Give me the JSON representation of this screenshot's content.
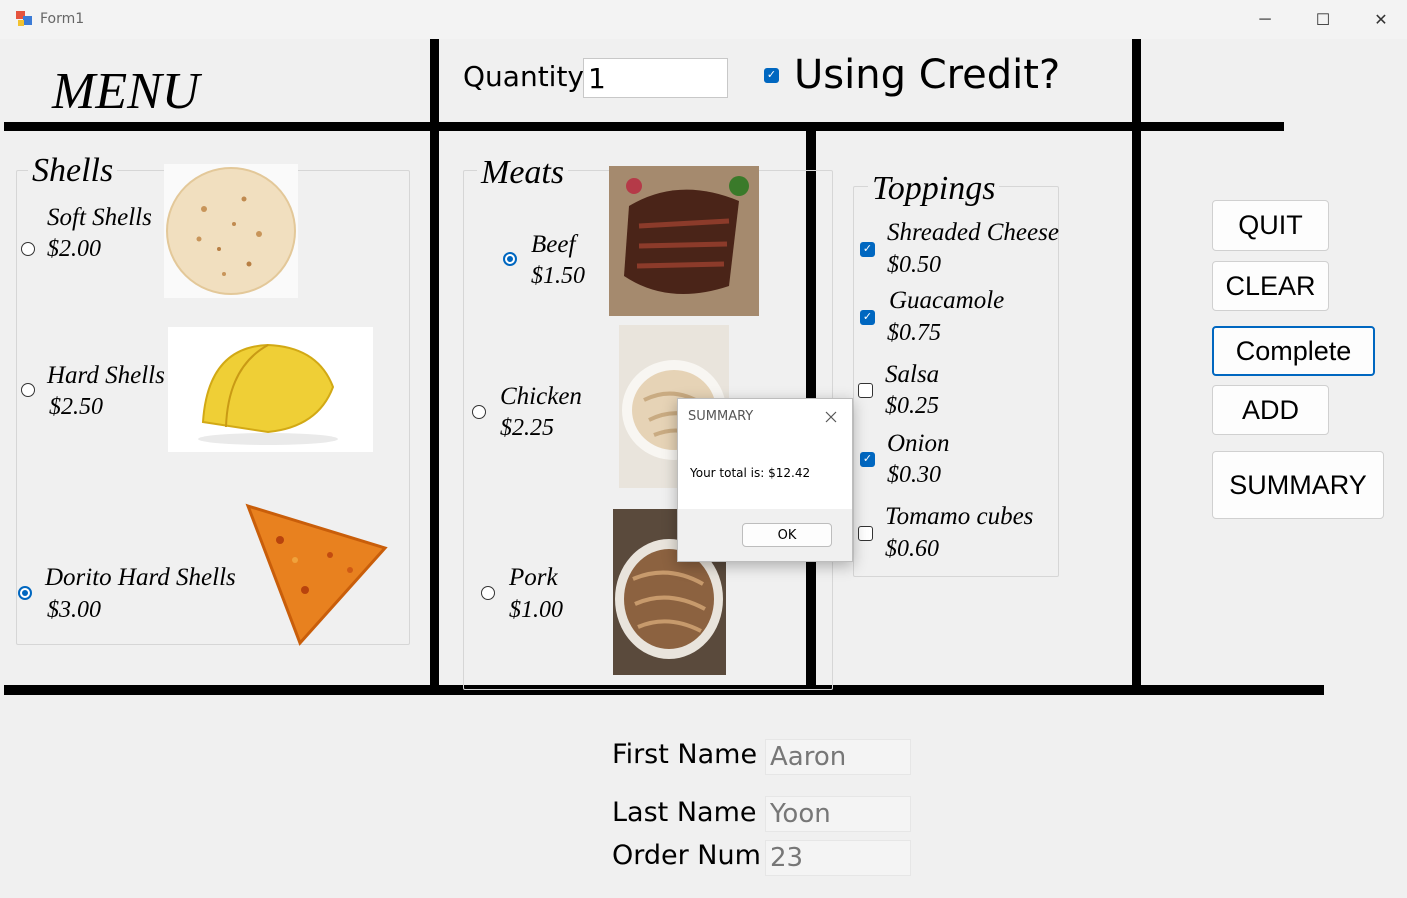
{
  "window": {
    "title": "Form1",
    "controls": {
      "minimize": "─",
      "maximize": "☐",
      "close": "✕"
    }
  },
  "header": {
    "menu_title": "MENU",
    "quantity_label": "Quantity",
    "quantity_value": "1",
    "using_credit_label": "Using Credit?",
    "using_credit_checked": true
  },
  "shells": {
    "title": "Shells",
    "items": [
      {
        "name": "Soft Shells",
        "price": "$2.00",
        "selected": false
      },
      {
        "name": "Hard Shells",
        "price": "$2.50",
        "selected": false
      },
      {
        "name": "Dorito Hard Shells",
        "price": "$3.00",
        "selected": true
      }
    ]
  },
  "meats": {
    "title": "Meats",
    "items": [
      {
        "name": "Beef",
        "price": "$1.50",
        "selected": true
      },
      {
        "name": "Chicken",
        "price": "$2.25",
        "selected": false
      },
      {
        "name": "Pork",
        "price": "$1.00",
        "selected": false
      }
    ]
  },
  "toppings": {
    "title": "Toppings",
    "items": [
      {
        "name": "Shreaded Cheese",
        "price": "$0.50",
        "checked": true
      },
      {
        "name": "Guacamole",
        "price": "$0.75",
        "checked": true
      },
      {
        "name": "Salsa",
        "price": "$0.25",
        "checked": false
      },
      {
        "name": "Onion",
        "price": "$0.30",
        "checked": true
      },
      {
        "name": "Tomamo cubes",
        "price": "$0.60",
        "checked": false
      }
    ]
  },
  "buttons": {
    "quit": "QUIT",
    "clear": "CLEAR",
    "complete": "Complete",
    "add": "ADD",
    "summary": "SUMMARY"
  },
  "customer": {
    "first_name_label": "First Name",
    "first_name_value": "Aaron",
    "last_name_label": "Last Name",
    "last_name_value": "Yoon",
    "order_num_label": "Order Num",
    "order_num_value": "23"
  },
  "dialog": {
    "title": "SUMMARY",
    "message": "Your total is: $12.42",
    "ok_label": "OK"
  },
  "colors": {
    "accent": "#0067c0",
    "background": "#f0f0f0",
    "divider": "#000000"
  }
}
